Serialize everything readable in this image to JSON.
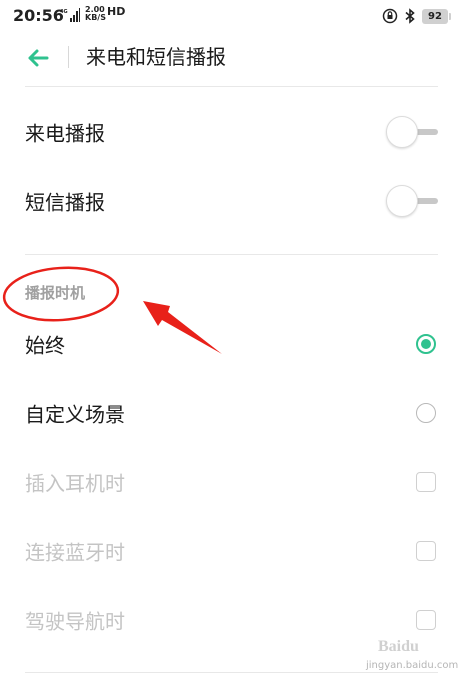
{
  "status_bar": {
    "time": "20:56",
    "network": "4G",
    "speed_value": "2.00",
    "speed_unit": "KB/S",
    "hd": "HD",
    "battery": "92"
  },
  "header": {
    "title": "来电和短信播报"
  },
  "toggles": [
    {
      "label": "来电播报",
      "on": false
    },
    {
      "label": "短信播报",
      "on": false
    }
  ],
  "timing_section": {
    "title": "播报时机",
    "options": [
      {
        "label": "始终",
        "selected": true
      },
      {
        "label": "自定义场景",
        "selected": false
      }
    ],
    "scenes": [
      {
        "label": "插入耳机时",
        "checked": false,
        "enabled": false
      },
      {
        "label": "连接蓝牙时",
        "checked": false,
        "enabled": false
      },
      {
        "label": "驾驶导航时",
        "checked": false,
        "enabled": false
      }
    ]
  },
  "colors": {
    "accent": "#2fc28f",
    "annotation": "#e8211a"
  },
  "watermark": {
    "text": "Baidu",
    "sub": "jingyan.baidu.com"
  }
}
